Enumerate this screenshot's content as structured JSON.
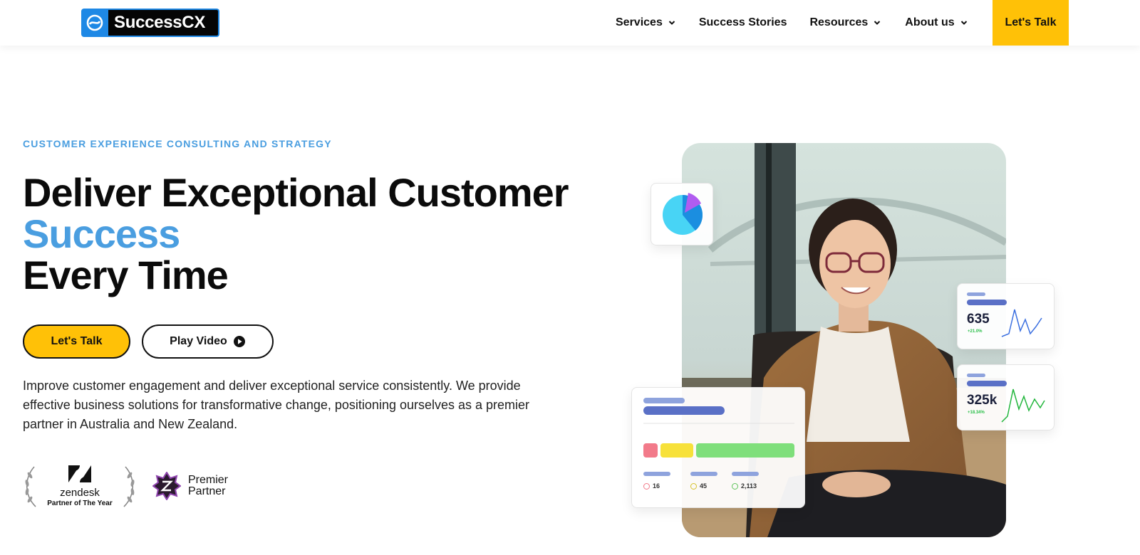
{
  "header": {
    "logo_text": "SuccessCX",
    "nav": [
      {
        "label": "Services",
        "has_dropdown": true
      },
      {
        "label": "Success Stories",
        "has_dropdown": false
      },
      {
        "label": "Resources",
        "has_dropdown": true
      },
      {
        "label": "About us",
        "has_dropdown": true
      }
    ],
    "cta_label": "Let's Talk"
  },
  "hero": {
    "eyebrow": "CUSTOMER EXPERIENCE CONSULTING AND STRATEGY",
    "title_line1": "Deliver Exceptional Customer",
    "title_accent": "Success",
    "title_line3": "Every Time",
    "primary_button": "Let's Talk",
    "secondary_button": "Play Video",
    "description": "Improve customer engagement and deliver exceptional service consistently. We provide effective business solutions for transformative change, positioning ourselves as a premier partner in Australia and New Zealand.",
    "badges": {
      "zendesk_name": "zendesk",
      "zendesk_award": "Partner of The Year",
      "premier_line1": "Premier",
      "premier_line2": "Partner"
    }
  },
  "visual": {
    "stat_cards": [
      {
        "value": "635",
        "delta": "+21.0%"
      },
      {
        "value": "325k",
        "delta": "+18.34%"
      }
    ],
    "status_counts": [
      "16",
      "45",
      "2,113"
    ]
  },
  "colors": {
    "accent_blue": "#4a9ee0",
    "cta_yellow": "#ffc107",
    "text_dark": "#0b0b0b"
  },
  "icons": [
    "chevron-down-icon",
    "play-circle-icon",
    "zendesk-logo-icon",
    "laurel-icon",
    "premier-star-icon",
    "pie-chart-icon",
    "sparkline-icon",
    "face-icon"
  ]
}
